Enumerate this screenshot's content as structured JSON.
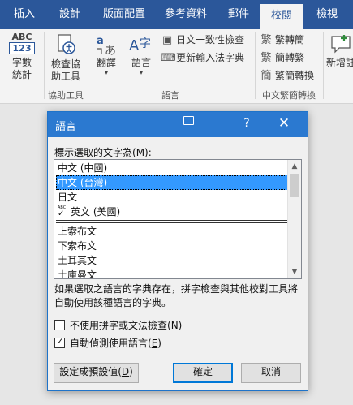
{
  "ribbon": {
    "tabs": [
      {
        "label": "插入",
        "active": false
      },
      {
        "label": "設計",
        "active": false
      },
      {
        "label": "版面配置",
        "active": false
      },
      {
        "label": "參考資料",
        "active": false
      },
      {
        "label": "郵件",
        "active": false
      },
      {
        "label": "校閱",
        "active": true
      },
      {
        "label": "檢視",
        "active": false
      }
    ],
    "word_count": {
      "badge_top": "ABC",
      "badge_bottom": "123",
      "label": "字數統計"
    },
    "accessibility": {
      "label": "檢查協助工具",
      "group": "協助工具"
    },
    "translate": {
      "label": "翻譯"
    },
    "language": {
      "label": "語言"
    },
    "language_group": "語言",
    "language_small": [
      "日文一致性檢查",
      "更新輸入法字典"
    ],
    "chinese_group": "中文繁簡轉換",
    "chinese_small": [
      "繁轉簡",
      "簡轉繁",
      "繁簡轉換"
    ],
    "new_comment": {
      "label": "新增註"
    }
  },
  "dialog": {
    "title": "語言",
    "help": "?",
    "close": "✕",
    "select_label": "標示選取的文字為(",
    "select_key": "M",
    "select_label_end": "):",
    "languages": [
      {
        "name": "中文 (中國)",
        "selected": false,
        "spell": false
      },
      {
        "name": "中文 (台灣)",
        "selected": true,
        "spell": false
      },
      {
        "name": "日文",
        "selected": false,
        "spell": false
      },
      {
        "name": "英文 (美國)",
        "selected": false,
        "spell": true
      },
      {
        "name": "上索布文",
        "selected": false,
        "spell": false
      },
      {
        "name": "下索布文",
        "selected": false,
        "spell": false
      },
      {
        "name": "土耳其文",
        "selected": false,
        "spell": false
      },
      {
        "name": "土庫曼文",
        "selected": false,
        "spell": false
      }
    ],
    "spell_badge": "ABC",
    "note": "如果選取之語言的字典存在，拼字檢查與其他校對工具將自動使用該種語言的字典。",
    "options": [
      {
        "label": "不使用拼字或文法檢查(",
        "key": "N",
        "end": ")",
        "checked": false
      },
      {
        "label": "自動偵測使用語言(",
        "key": "E",
        "end": ")",
        "checked": true
      }
    ],
    "buttons": {
      "default_prefix": "設定成預設值(",
      "default_key": "D",
      "default_end": ")",
      "ok": "確定",
      "cancel": "取消"
    }
  }
}
